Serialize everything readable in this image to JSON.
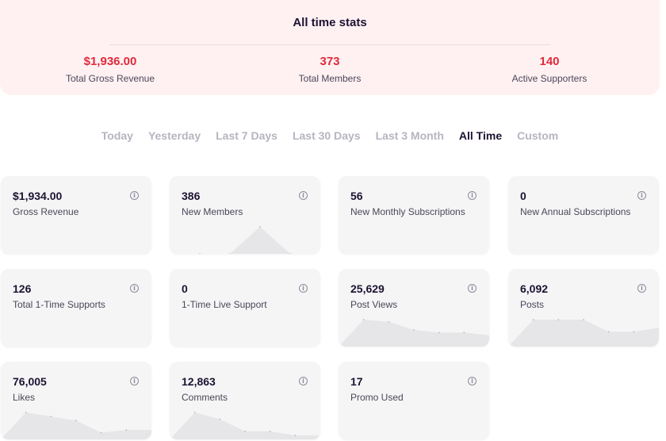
{
  "summary": {
    "title": "All time stats",
    "stats": [
      {
        "value": "$1,936.00",
        "label": "Total Gross Revenue"
      },
      {
        "value": "373",
        "label": "Total Members"
      },
      {
        "value": "140",
        "label": "Active Supporters"
      }
    ],
    "value_color": "#e02a3b"
  },
  "range_tabs": [
    "Today",
    "Yesterday",
    "Last 7 Days",
    "Last 30 Days",
    "Last 3 Month",
    "All Time",
    "Custom"
  ],
  "active_range": "All Time",
  "cards": [
    {
      "value": "$1,934.00",
      "label": "Gross Revenue",
      "icon": "info-icon"
    },
    {
      "value": "386",
      "label": "New Members",
      "icon": "info-icon",
      "trend": [
        0,
        0,
        0,
        1,
        0,
        0
      ]
    },
    {
      "value": "56",
      "label": "New Monthly Subscriptions",
      "icon": "info-icon"
    },
    {
      "value": "0",
      "label": "New Annual Subscriptions",
      "icon": "info-icon"
    },
    {
      "value": "126",
      "label": "Total 1-Time Supports",
      "icon": "info-icon"
    },
    {
      "value": "0",
      "label": "1-Time Live Support",
      "icon": "info-icon"
    },
    {
      "value": "25,629",
      "label": "Post Views",
      "icon": "info-icon",
      "trend": [
        0,
        1,
        0.92,
        0.62,
        0.52,
        0.52,
        0.42
      ]
    },
    {
      "value": "6,092",
      "label": "Posts",
      "icon": "info-icon",
      "trend": [
        0,
        1,
        1,
        1,
        0.55,
        0.55,
        0.7
      ]
    },
    {
      "value": "76,005",
      "label": "Likes",
      "icon": "info-icon",
      "trend": [
        0,
        1,
        0.85,
        0.7,
        0.25,
        0.35,
        0.35
      ]
    },
    {
      "value": "12,863",
      "label": "Comments",
      "icon": "info-icon",
      "trend": [
        0,
        1,
        0.75,
        0.3,
        0.3,
        0.15,
        0.15
      ]
    },
    {
      "value": "17",
      "label": "Promo Used",
      "icon": "info-icon"
    }
  ]
}
